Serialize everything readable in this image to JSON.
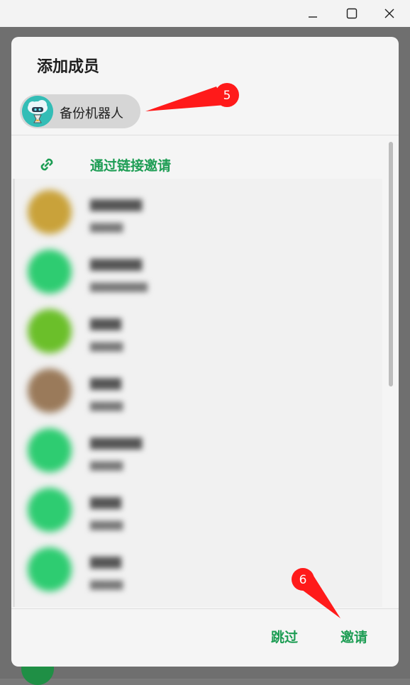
{
  "window": {
    "minimize_icon": "minimize-icon",
    "maximize_icon": "maximize-icon",
    "close_icon": "close-icon"
  },
  "dialog": {
    "title": "添加成员",
    "selected_chip": {
      "label": "备份机器人",
      "avatar_icon": "robot-cloud-avatar"
    },
    "invite_link": {
      "label": "通过链接邀请",
      "icon": "link-icon"
    },
    "footer": {
      "skip_label": "跳过",
      "invite_label": "邀请"
    }
  },
  "annotations": {
    "marker_5": "5",
    "marker_6": "6"
  },
  "colors": {
    "accent_green": "#1d9d54",
    "annotation_red": "#ff1a1a",
    "avatar_green": "#2ecc71"
  }
}
